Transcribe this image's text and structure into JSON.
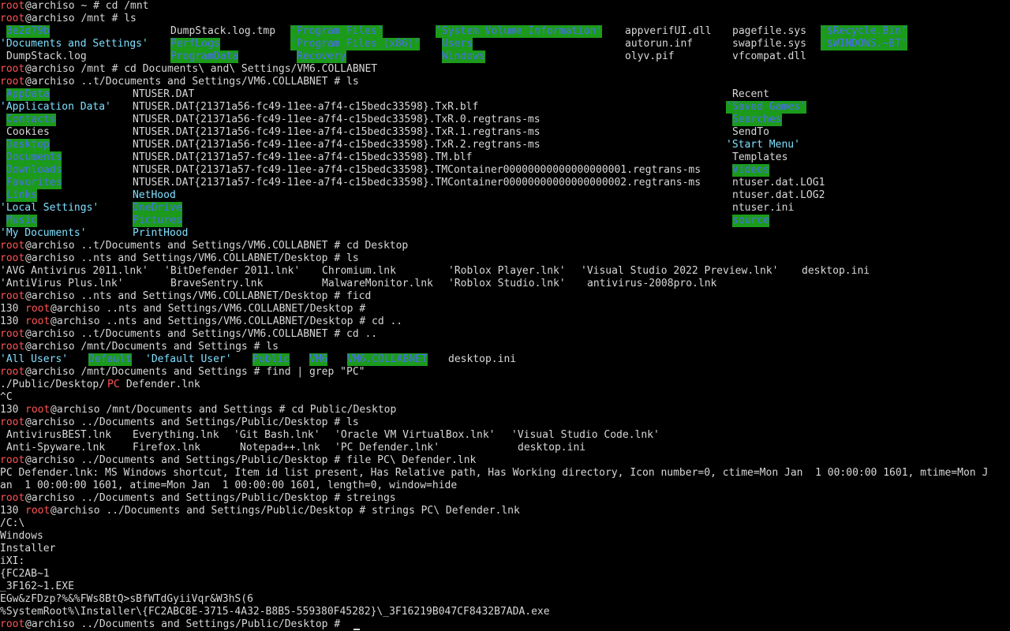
{
  "terminal": {
    "lines": [
      [
        [
          0,
          "root",
          "r"
        ],
        [
          4,
          "@archiso ~ # cd /mnt",
          "t"
        ]
      ],
      [
        [
          0,
          "root",
          "r"
        ],
        [
          4,
          "@archiso /mnt # ls",
          "t"
        ]
      ],
      [
        [
          1,
          "3e2d79b",
          "hl"
        ],
        [
          27,
          "DumpStack.log.tmp",
          "t"
        ],
        [
          46,
          "'Program Files'",
          "hl"
        ],
        [
          69,
          "'System Volume Information'",
          "hl"
        ],
        [
          99,
          "appverifUI.dll",
          "t"
        ],
        [
          116,
          "pagefile.sys",
          "t"
        ],
        [
          130,
          "'$Recycle.Bin'",
          "hl"
        ]
      ],
      [
        [
          0,
          "'Documents and Settings'",
          "c"
        ],
        [
          27,
          "PerfLogs",
          "hl"
        ],
        [
          46,
          "'Program Files (x86)'",
          "hl"
        ],
        [
          70,
          "Users",
          "hl"
        ],
        [
          99,
          "autorun.inf",
          "t"
        ],
        [
          116,
          "swapfile.sys",
          "t"
        ],
        [
          130,
          "'$WINDOWS.~BT'",
          "hl"
        ]
      ],
      [
        [
          1,
          "DumpStack.log",
          "t"
        ],
        [
          27,
          "ProgramData",
          "hl"
        ],
        [
          47,
          "Recovery",
          "hl"
        ],
        [
          70,
          "Windows",
          "hl"
        ],
        [
          99,
          "olyv.pif",
          "t"
        ],
        [
          116,
          "vfcompat.dll",
          "t"
        ]
      ],
      [
        [
          0,
          "root",
          "r"
        ],
        [
          4,
          "@archiso /mnt # cd Documents\\ and\\ Settings/VM6.COLLABNET",
          "t"
        ]
      ],
      [
        [
          0,
          "root",
          "r"
        ],
        [
          4,
          "@archiso ..t/Documents and Settings/VM6.COLLABNET # ls",
          "t"
        ]
      ],
      [
        [
          1,
          "AppData",
          "hl"
        ],
        [
          21,
          "NTUSER.DAT",
          "t"
        ],
        [
          116,
          "Recent",
          "t"
        ]
      ],
      [
        [
          0,
          "'Application Data'",
          "c"
        ],
        [
          21,
          "NTUSER.DAT{21371a56-fc49-11ee-a7f4-c15bedc33598}.TxR.blf",
          "t"
        ],
        [
          115,
          "'Saved Games'",
          "hl"
        ]
      ],
      [
        [
          1,
          "Contacts",
          "hl"
        ],
        [
          21,
          "NTUSER.DAT{21371a56-fc49-11ee-a7f4-c15bedc33598}.TxR.0.regtrans-ms",
          "t"
        ],
        [
          116,
          "Searches",
          "hl"
        ]
      ],
      [
        [
          1,
          "Cookies",
          "t"
        ],
        [
          21,
          "NTUSER.DAT{21371a56-fc49-11ee-a7f4-c15bedc33598}.TxR.1.regtrans-ms",
          "t"
        ],
        [
          116,
          "SendTo",
          "t"
        ]
      ],
      [
        [
          1,
          "Desktop",
          "hl"
        ],
        [
          21,
          "NTUSER.DAT{21371a56-fc49-11ee-a7f4-c15bedc33598}.TxR.2.regtrans-ms",
          "t"
        ],
        [
          115,
          "'Start Menu'",
          "c"
        ]
      ],
      [
        [
          1,
          "Documents",
          "hl"
        ],
        [
          21,
          "NTUSER.DAT{21371a57-fc49-11ee-a7f4-c15bedc33598}.TM.blf",
          "t"
        ],
        [
          116,
          "Templates",
          "t"
        ]
      ],
      [
        [
          1,
          "Downloads",
          "hl"
        ],
        [
          21,
          "NTUSER.DAT{21371a57-fc49-11ee-a7f4-c15bedc33598}.TMContainer00000000000000000001.regtrans-ms",
          "t"
        ],
        [
          116,
          "Videos",
          "hl"
        ]
      ],
      [
        [
          1,
          "Favorites",
          "hl"
        ],
        [
          21,
          "NTUSER.DAT{21371a57-fc49-11ee-a7f4-c15bedc33598}.TMContainer00000000000000000002.regtrans-ms",
          "t"
        ],
        [
          116,
          "ntuser.dat.LOG1",
          "t"
        ]
      ],
      [
        [
          1,
          "Links",
          "hl"
        ],
        [
          21,
          "NetHood",
          "c"
        ],
        [
          116,
          "ntuser.dat.LOG2",
          "t"
        ]
      ],
      [
        [
          0,
          "'Local Settings'",
          "c"
        ],
        [
          21,
          "OneDrive",
          "hl"
        ],
        [
          116,
          "ntuser.ini",
          "t"
        ]
      ],
      [
        [
          1,
          "Music",
          "hl"
        ],
        [
          21,
          "Pictures",
          "hl"
        ],
        [
          116,
          "source",
          "hl"
        ]
      ],
      [
        [
          0,
          "'My Documents'",
          "c"
        ],
        [
          21,
          "PrintHood",
          "c"
        ]
      ],
      [
        [
          0,
          "root",
          "r"
        ],
        [
          4,
          "@archiso ..t/Documents and Settings/VM6.COLLABNET # cd Desktop",
          "t"
        ]
      ],
      [
        [
          0,
          "root",
          "r"
        ],
        [
          4,
          "@archiso ..nts and Settings/VM6.COLLABNET/Desktop # ls",
          "t"
        ]
      ],
      [
        [
          0,
          "'AVG Antivirus 2011.lnk'",
          "t"
        ],
        [
          26,
          "'BitDefender 2011.lnk'",
          "t"
        ],
        [
          51,
          "Chromium.lnk",
          "t"
        ],
        [
          71,
          "'Roblox Player.lnk'",
          "t"
        ],
        [
          92,
          "'Visual Studio 2022 Preview.lnk'",
          "t"
        ],
        [
          127,
          "desktop.ini",
          "t"
        ]
      ],
      [
        [
          0,
          "'AntiVirus Plus.lnk'",
          "t"
        ],
        [
          27,
          "BraveSentry.lnk",
          "t"
        ],
        [
          51,
          "MalwareMonitor.lnk",
          "t"
        ],
        [
          71,
          "'Roblox Studio.lnk'",
          "t"
        ],
        [
          93,
          "antivirus-2008pro.lnk",
          "t"
        ]
      ],
      [
        [
          0,
          "root",
          "r"
        ],
        [
          4,
          "@archiso ..nts and Settings/VM6.COLLABNET/Desktop # ficd",
          "t"
        ]
      ],
      [
        [
          0,
          "130 ",
          "t"
        ],
        [
          4,
          "root",
          "r"
        ],
        [
          8,
          "@archiso ..nts and Settings/VM6.COLLABNET/Desktop #",
          "t"
        ]
      ],
      [
        [
          0,
          "130 ",
          "t"
        ],
        [
          4,
          "root",
          "r"
        ],
        [
          8,
          "@archiso ..nts and Settings/VM6.COLLABNET/Desktop # cd ..",
          "t"
        ]
      ],
      [
        [
          0,
          "root",
          "r"
        ],
        [
          4,
          "@archiso ..t/Documents and Settings/VM6.COLLABNET # cd ..",
          "t"
        ]
      ],
      [
        [
          0,
          "root",
          "r"
        ],
        [
          4,
          "@archiso /mnt/Documents and Settings # ls",
          "t"
        ]
      ],
      [
        [
          0,
          "'All Users'",
          "c"
        ],
        [
          14,
          "Default",
          "hl"
        ],
        [
          23,
          "'Default User'",
          "c"
        ],
        [
          40,
          "Public",
          "hl"
        ],
        [
          49,
          "VM6",
          "hl"
        ],
        [
          55,
          "VM6.COLLABNET",
          "hl"
        ],
        [
          71,
          "desktop.ini",
          "t"
        ]
      ],
      [
        [
          0,
          "root",
          "r"
        ],
        [
          4,
          "@archiso /mnt/Documents and Settings # find | grep \"PC\"",
          "t"
        ]
      ],
      [
        [
          0,
          "./Public/Desktop/",
          "t"
        ],
        [
          17,
          "PC",
          "r"
        ],
        [
          19,
          " Defender.lnk",
          "t"
        ]
      ],
      [
        [
          0,
          "^C",
          "t"
        ]
      ],
      [
        [
          0,
          "130 ",
          "t"
        ],
        [
          4,
          "root",
          "r"
        ],
        [
          8,
          "@archiso /mnt/Documents and Settings # cd Public/Desktop",
          "t"
        ]
      ],
      [
        [
          0,
          "root",
          "r"
        ],
        [
          4,
          "@archiso ../Documents and Settings/Public/Desktop # ls",
          "t"
        ]
      ],
      [
        [
          1,
          "AntivirusBEST.lnk",
          "t"
        ],
        [
          21,
          "Everything.lnk",
          "t"
        ],
        [
          37,
          "'Git Bash.lnk'",
          "t"
        ],
        [
          53,
          "'Oracle VM VirtualBox.lnk'",
          "t"
        ],
        [
          81,
          "'Visual Studio Code.lnk'",
          "t"
        ]
      ],
      [
        [
          1,
          "Anti-Spyware.lnk",
          "t"
        ],
        [
          21,
          "Firefox.lnk",
          "t"
        ],
        [
          38,
          "Notepad++.lnk",
          "t"
        ],
        [
          53,
          "'PC Defender.lnk'",
          "t"
        ],
        [
          82,
          "desktop.ini",
          "t"
        ]
      ],
      [
        [
          0,
          "root",
          "r"
        ],
        [
          4,
          "@archiso ../Documents and Settings/Public/Desktop # file PC\\ Defender.lnk",
          "t"
        ]
      ],
      [
        [
          0,
          "PC Defender.lnk: MS Windows shortcut, Item id list present, Has Relative path, Has Working directory, Icon number=0, ctime=Mon Jan  1 00:00:00 1601, mtime=Mon J",
          "t"
        ]
      ],
      [
        [
          0,
          "an  1 00:00:00 1601, atime=Mon Jan  1 00:00:00 1601, length=0, window=hide",
          "t"
        ]
      ],
      [
        [
          0,
          "root",
          "r"
        ],
        [
          4,
          "@archiso ../Documents and Settings/Public/Desktop # streings",
          "t"
        ]
      ],
      [
        [
          0,
          "130 ",
          "t"
        ],
        [
          4,
          "root",
          "r"
        ],
        [
          8,
          "@archiso ../Documents and Settings/Public/Desktop # strings PC\\ Defender.lnk",
          "t"
        ]
      ],
      [
        [
          0,
          "/C:\\",
          "t"
        ]
      ],
      [
        [
          0,
          "Windows",
          "t"
        ]
      ],
      [
        [
          0,
          "Installer",
          "t"
        ]
      ],
      [
        [
          0,
          "iXI:",
          "t"
        ]
      ],
      [
        [
          0,
          "{FC2AB~1",
          "t"
        ]
      ],
      [
        [
          0,
          "_3F162~1.EXE",
          "t"
        ]
      ],
      [
        [
          0,
          "EGw&zFDzp?%&%FWs8BtQ>sBfWTdGyiiVqr&W3hS(6",
          "t"
        ]
      ],
      [
        [
          0,
          "%SystemRoot%\\Installer\\{FC2ABC8E-3715-4A32-B8B5-559380F45282}\\_3F16219B047CF8432B7ADA.exe",
          "t"
        ]
      ],
      [
        [
          0,
          "root",
          "r"
        ],
        [
          4,
          "@archiso ../Documents and Settings/Public/Desktop # ",
          "t"
        ]
      ]
    ]
  }
}
